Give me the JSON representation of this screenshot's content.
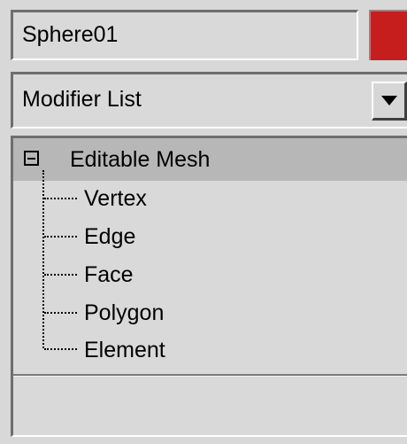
{
  "object": {
    "name": "Sphere01",
    "color": "#c61d1d"
  },
  "modifier_list": {
    "label": "Modifier List",
    "button_icon": "chevron-down-icon"
  },
  "stack": {
    "root": {
      "label": "Editable Mesh",
      "expanded": true,
      "expander_icon": "collapse-minus-icon"
    },
    "items": [
      {
        "label": "Vertex"
      },
      {
        "label": "Edge"
      },
      {
        "label": "Face"
      },
      {
        "label": "Polygon"
      },
      {
        "label": "Element"
      }
    ]
  }
}
